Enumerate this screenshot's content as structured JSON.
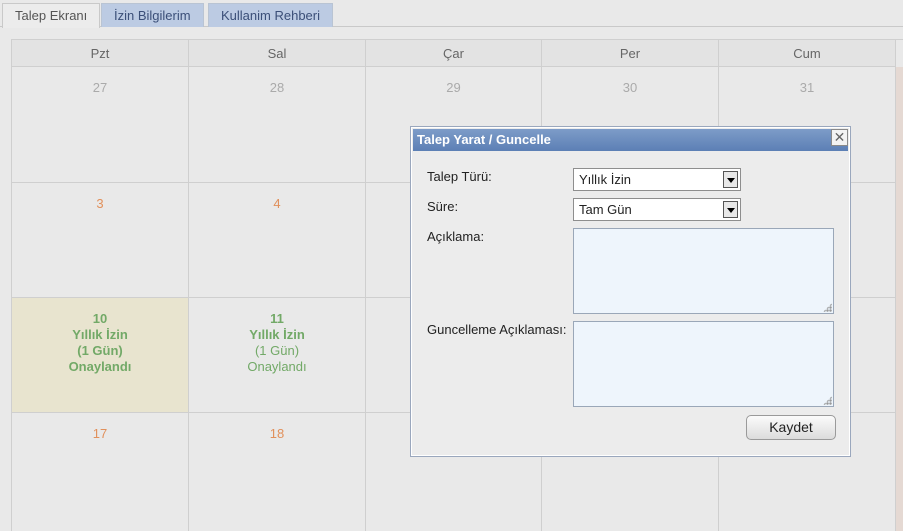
{
  "tabs": [
    {
      "label": "Talep Ekranı",
      "active": true
    },
    {
      "label": "İzin Bilgilerim",
      "active": false
    },
    {
      "label": "Kullanim Rehberi",
      "active": false
    }
  ],
  "calendar": {
    "days": [
      "Pzt",
      "Sal",
      "Çar",
      "Per",
      "Cum"
    ],
    "weeks": [
      [
        "27",
        "28",
        "29",
        "30",
        "31"
      ],
      [
        "3",
        "4",
        "",
        "",
        ""
      ],
      [
        "10",
        "11",
        "",
        "",
        ""
      ],
      [
        "17",
        "18",
        "",
        "",
        ""
      ]
    ],
    "events": {
      "mon10": {
        "day": "10",
        "type": "Yıllık İzin",
        "duration": "(1 Gün)",
        "status": "Onaylandı"
      },
      "tue11": {
        "day": "11",
        "type": "Yıllık İzin",
        "duration": "(1 Gün)",
        "status": "Onaylandı"
      }
    }
  },
  "dialog": {
    "title": "Talep Yarat / Guncelle",
    "close_symbol": "✕",
    "fields": {
      "type_label": "Talep Türü:",
      "type_value": "Yıllık İzin",
      "duration_label": "Süre:",
      "duration_value": "Tam Gün",
      "description_label": "Açıklama:",
      "description_value": "",
      "update_label": "Guncelleme Açıklaması:",
      "update_value": ""
    },
    "save_label": "Kaydet"
  },
  "colors": {
    "tab_inactive": "#bccbe3",
    "dialog_title": "#5c7fb5",
    "leave_green": "#72a967",
    "day_orange": "#e1905b",
    "highlight_cell": "#e8e4cf"
  }
}
